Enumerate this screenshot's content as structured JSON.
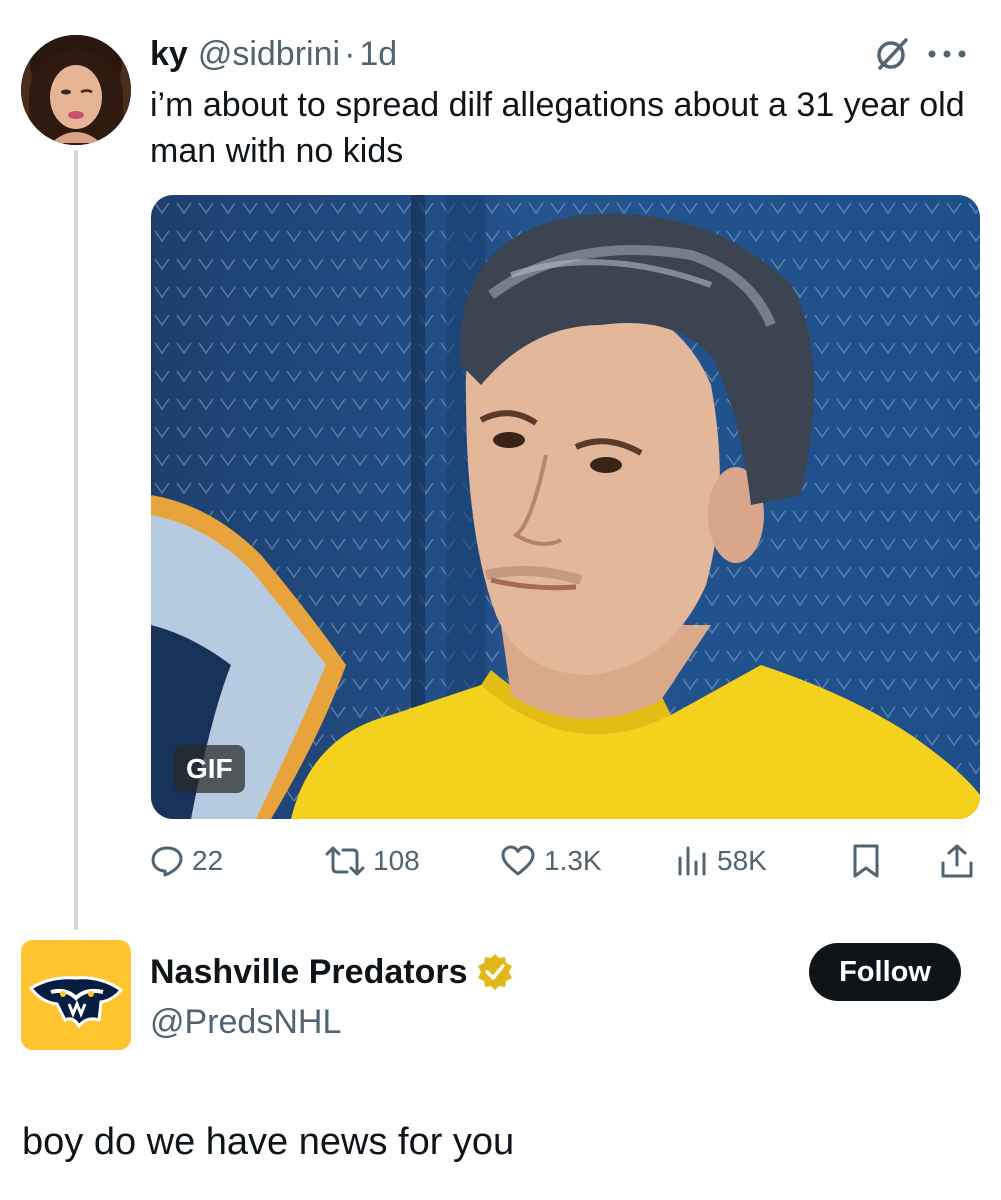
{
  "tweet": {
    "author_name": "ky",
    "author_handle": "@sidbrini",
    "separator": "·",
    "time": "1d",
    "text": "i’m about to spread dilf allegations about a 31 year old man with no kids",
    "media_badge": "GIF",
    "stats": {
      "replies": "22",
      "reposts": "108",
      "likes": "1.3K",
      "views": "58K"
    }
  },
  "reply": {
    "author_name": "Nashville Predators",
    "author_handle": "@PredsNHL",
    "follow_label": "Follow",
    "text": "boy do we have news for you"
  },
  "icons": {
    "grok": "grok-icon",
    "more": "more-icon",
    "reply": "reply-icon",
    "repost": "repost-icon",
    "like": "heart-icon",
    "views": "views-icon",
    "bookmark": "bookmark-icon",
    "share": "share-icon",
    "verified": "verified-badge-icon"
  },
  "colors": {
    "text_primary": "#0f1419",
    "text_secondary": "#536471",
    "thread_line": "#cfd9de",
    "follow_button": "#0f1419",
    "preds_gold": "#fec52e",
    "verified_gold": "#e2b719"
  }
}
